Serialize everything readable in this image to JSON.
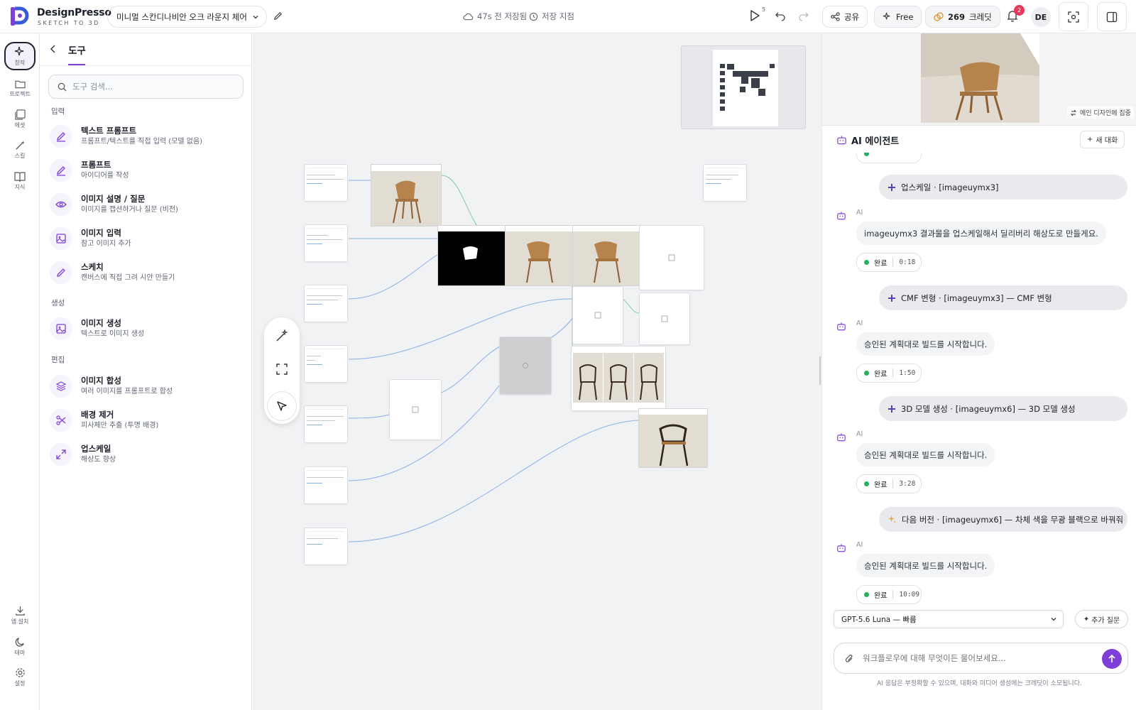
{
  "app": {
    "name": "DesignPresso",
    "tagline": "SKETCH TO 3D"
  },
  "header": {
    "project_name": "미니멀 스칸디나비안 오크 라운지 체어",
    "save_status": "47s 전 저장됨",
    "save_point": "저장 지점",
    "run_count": "5",
    "share_label": "공유",
    "plan_label": "Free",
    "credits_value": "269",
    "credits_label": "크레딧",
    "notifications": "2",
    "avatar_initials": "DE"
  },
  "rail": {
    "items": [
      {
        "label": "창작",
        "icon": "sparkle-icon",
        "active": true
      },
      {
        "label": "프로젝트",
        "icon": "folder-icon"
      },
      {
        "label": "에셋",
        "icon": "image-stack-icon"
      },
      {
        "label": "스킬",
        "icon": "magic-wand-icon"
      },
      {
        "label": "지식",
        "icon": "book-icon"
      }
    ],
    "bottom": [
      {
        "label": "앱 설치",
        "icon": "download-icon"
      },
      {
        "label": "테마",
        "icon": "moon-icon"
      },
      {
        "label": "설정",
        "icon": "gear-icon"
      }
    ]
  },
  "tools": {
    "title": "도구",
    "search_placeholder": "도구 검색...",
    "sections": {
      "input": "입력",
      "generate": "생성",
      "edit": "편집"
    },
    "items": [
      {
        "title": "텍스트 프롬프트",
        "desc": "프롬프트/텍스트를 직접 입력 (모델 없음)",
        "icon": "pen-icon"
      },
      {
        "title": "프롬프트",
        "desc": "아이디어를 작성",
        "icon": "pen-icon"
      },
      {
        "title": "이미지 설명 / 질문",
        "desc": "이미지를 캡션하거나 질문 (비전)",
        "icon": "eye-icon"
      },
      {
        "title": "이미지 입력",
        "desc": "참고 이미지 추가",
        "icon": "image-icon"
      },
      {
        "title": "스케치",
        "desc": "캔버스에 직접 그려 시안 만들기",
        "icon": "pencil-icon"
      },
      {
        "title": "이미지 생성",
        "desc": "텍스트로 이미지 생성",
        "icon": "image-icon"
      },
      {
        "title": "이미지 합성",
        "desc": "여러 이미지를 프롬프트로 합성",
        "icon": "layers-icon"
      },
      {
        "title": "배경 제거",
        "desc": "피사체만 추출 (투명 배경)",
        "icon": "scissors-icon"
      },
      {
        "title": "업스케일",
        "desc": "해상도 향상",
        "icon": "expand-icon"
      }
    ]
  },
  "preview": {
    "focus_label": "메인 디자인에 집중"
  },
  "agent": {
    "title": "AI 에이전트",
    "new_chat": "새 대화",
    "ai_label": "AI",
    "messages": [
      {
        "type": "user",
        "icon": "plus",
        "text": "업스케일 · [imageuymx3]"
      },
      {
        "type": "ai",
        "text": "imageuymx3 결과물을 업스케일해서 딜리버리 해상도로 만들게요.",
        "status": "완료",
        "time": "0:18"
      },
      {
        "type": "user",
        "icon": "plus",
        "text": "CMF 변형 · [imageuymx3] — CMF 변형"
      },
      {
        "type": "ai",
        "text": "승인된 계획대로 빌드를 시작합니다.",
        "status": "완료",
        "time": "1:50"
      },
      {
        "type": "user",
        "icon": "plus",
        "text": "3D 모델 생성 · [imageuymx6] — 3D 모델 생성"
      },
      {
        "type": "ai",
        "text": "승인된 계획대로 빌드를 시작합니다.",
        "status": "완료",
        "time": "3:28"
      },
      {
        "type": "user",
        "icon": "sparkle",
        "text": "다음 버전 · [imageuymx6] — 차체 색을 무광 블랙으로 바꿔줘"
      },
      {
        "type": "ai",
        "text": "승인된 계획대로 빌드를 시작합니다.",
        "status": "완료",
        "time": "10:09"
      }
    ],
    "model": "GPT-5.6 Luna — 빠름",
    "more_question": "추가 질문",
    "input_placeholder": "워크플로우에 대해 무엇이든 물어보세요...",
    "disclaimer": "AI 응답은 부정확할 수 있으며, 대화와 미디어 생성에는 크레딧이 소모됩니다."
  },
  "colors": {
    "accent": "#7e3fd6",
    "edge": "#8ab0e8",
    "done": "#21b35a",
    "badge": "#e5395c"
  }
}
